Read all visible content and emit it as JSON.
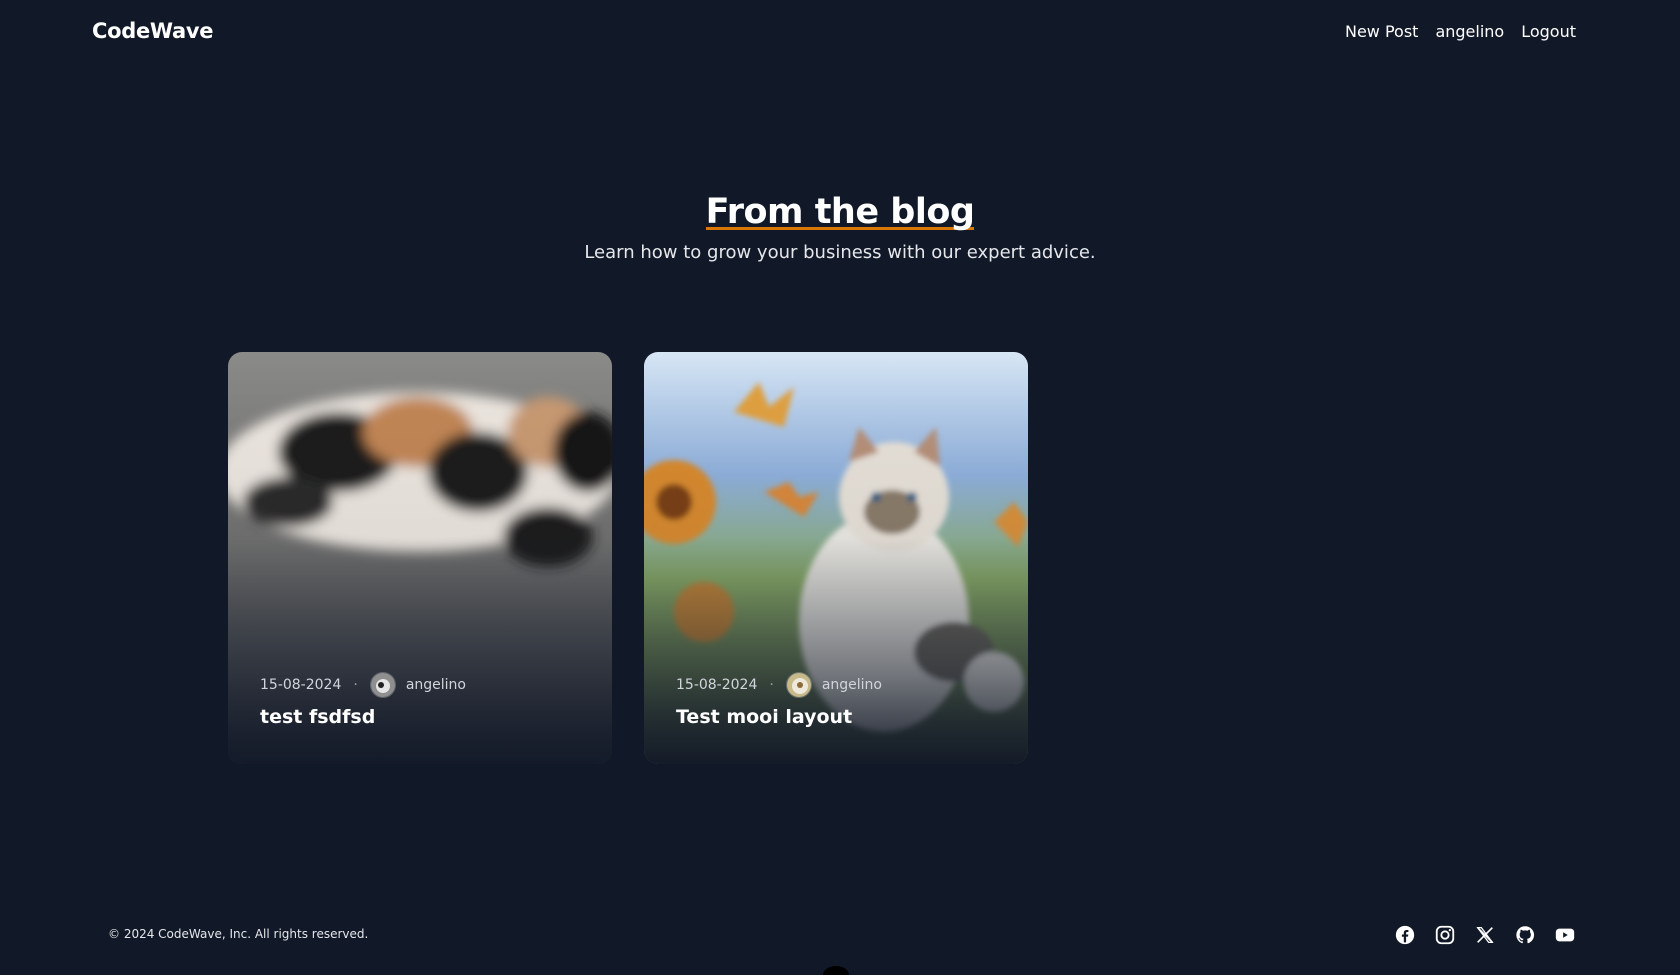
{
  "header": {
    "brand": "CodeWave",
    "nav": [
      {
        "label": "New Post"
      },
      {
        "label": "angelino"
      },
      {
        "label": "Logout"
      }
    ]
  },
  "hero": {
    "title": "From the blog",
    "subtitle": "Learn how to grow your business with our expert advice."
  },
  "posts": [
    {
      "date": "15-08-2024",
      "author": "angelino",
      "title": "test fsdfsd",
      "image_icon": "calico-cat-photo"
    },
    {
      "date": "15-08-2024",
      "author": "angelino",
      "title": "Test mooi layout",
      "image_icon": "watercolor-kitten-butterflies-painting"
    }
  ],
  "footer": {
    "copyright": "© 2024 CodeWave, Inc. All rights reserved.",
    "social": [
      "facebook-icon",
      "instagram-icon",
      "x-icon",
      "github-icon",
      "youtube-icon"
    ]
  },
  "colors": {
    "background": "#111827",
    "accent_underline": "#d97706"
  }
}
